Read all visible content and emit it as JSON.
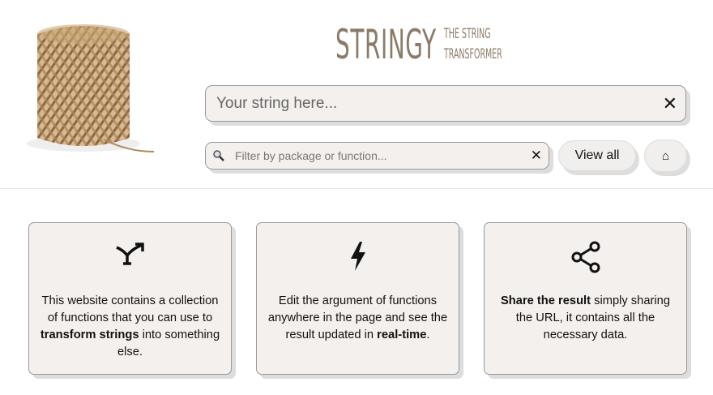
{
  "header": {
    "logo_title": "STRINGY",
    "logo_tagline_1": "THE STRING",
    "logo_tagline_2": "TRANSFORMER"
  },
  "main_input": {
    "placeholder": "Your string here...",
    "clear_icon": "close-icon"
  },
  "filter": {
    "placeholder": "Filter by package or function...",
    "search_icon": "magnifier-icon",
    "clear_icon": "close-icon"
  },
  "buttons": {
    "view_all": "View all",
    "home": "⌂"
  },
  "cards": [
    {
      "icon": "split-arrow-icon",
      "parts": [
        {
          "t": "This website contains a collection of functions that you can use to ",
          "b": false
        },
        {
          "t": "transform strings",
          "b": true
        },
        {
          "t": " into something else.",
          "b": false
        }
      ]
    },
    {
      "icon": "lightning-icon",
      "parts": [
        {
          "t": "Edit the argument of functions anywhere in the page and see the result updated in ",
          "b": false
        },
        {
          "t": "real-time",
          "b": true
        },
        {
          "t": ".",
          "b": false
        }
      ]
    },
    {
      "icon": "share-icon",
      "parts": [
        {
          "t": "Share the result",
          "b": true
        },
        {
          "t": " simply sharing the URL, it contains all the necessary data.",
          "b": false
        }
      ]
    }
  ]
}
